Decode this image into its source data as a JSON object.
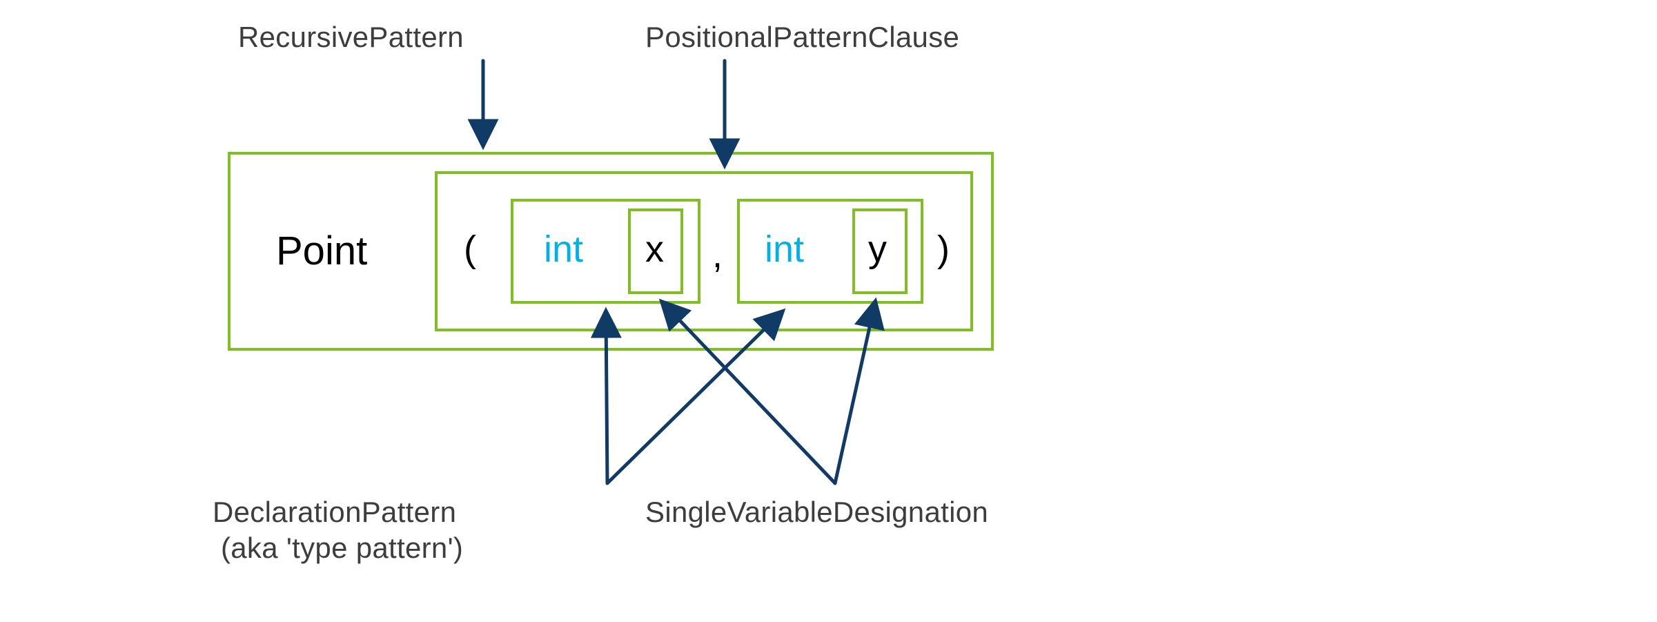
{
  "labels": {
    "recursive_pattern": "RecursivePattern",
    "positional_pattern_clause": "PositionalPatternClause",
    "declaration_pattern_line1": "DeclarationPattern",
    "declaration_pattern_line2": " (aka 'type pattern')",
    "single_variable_designation": "SingleVariableDesignation"
  },
  "tokens": {
    "point": "Point",
    "lparen": "(",
    "int1": "int",
    "x": "x",
    "comma": ",",
    "int2": "int",
    "y": "y",
    "rparen": ")"
  },
  "colors": {
    "green": "#7fbf1f",
    "navy": "#0f3b66",
    "cyan": "#00b0e6",
    "grey": "#3d3d3d"
  }
}
